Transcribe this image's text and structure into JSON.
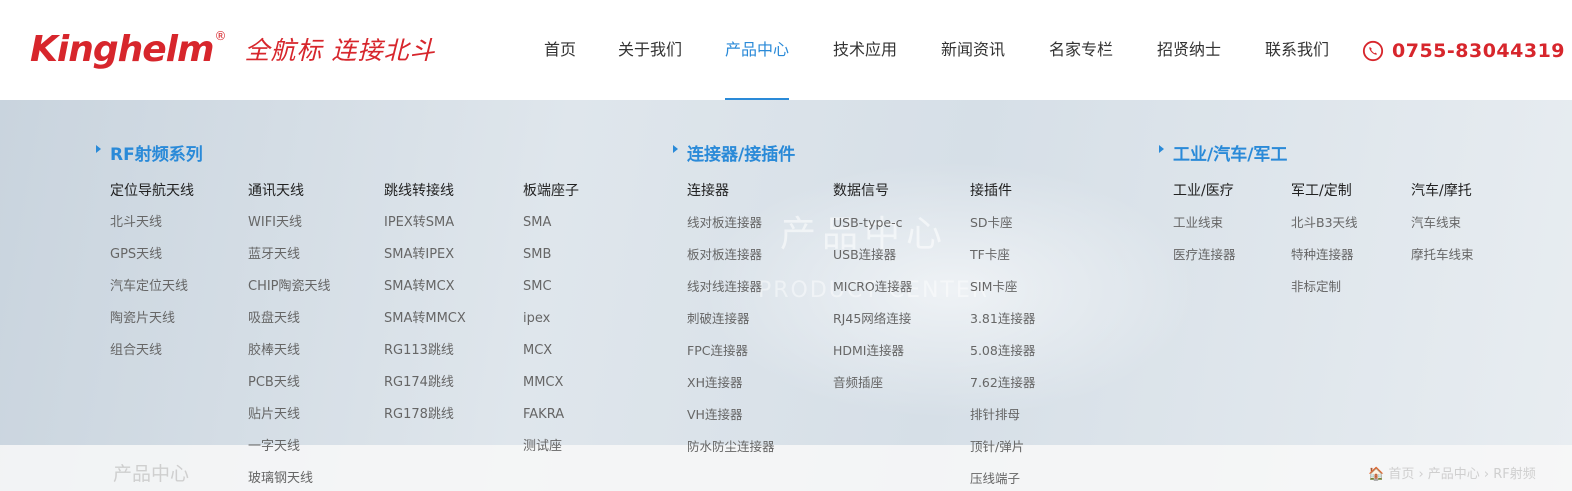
{
  "brand": {
    "logo_text": "Kinghelm",
    "registered": "®",
    "slogan": "全航标 连接北斗"
  },
  "nav": [
    {
      "label": "首页",
      "active": false
    },
    {
      "label": "关于我们",
      "active": false
    },
    {
      "label": "产品中心",
      "active": true
    },
    {
      "label": "技术应用",
      "active": false
    },
    {
      "label": "新闻资讯",
      "active": false
    },
    {
      "label": "名家专栏",
      "active": false
    },
    {
      "label": "招贤纳士",
      "active": false
    },
    {
      "label": "联系我们",
      "active": false
    }
  ],
  "phone": {
    "icon": "phone-icon",
    "number": "0755-83044319"
  },
  "banner": {
    "title": "产品中心",
    "subtitle": "PRODUCT CENTER"
  },
  "subbar": {
    "title": "产品中心",
    "breadcrumb": "🏠 首页 › 产品中心 › RF射频"
  },
  "mega_menu": {
    "groups": [
      {
        "title": "RF射频系列",
        "columns": [
          {
            "heading": "定位导航天线",
            "items": [
              "北斗天线",
              "GPS天线",
              "汽车定位天线",
              "陶瓷片天线",
              "组合天线"
            ]
          },
          {
            "heading": "通讯天线",
            "items": [
              "WIFI天线",
              "蓝牙天线",
              "CHIP陶瓷天线",
              "吸盘天线",
              "胶棒天线",
              "PCB天线",
              "贴片天线",
              "一字天线",
              "玻璃钢天线"
            ]
          },
          {
            "heading": "跳线转接线",
            "items": [
              "IPEX转SMA",
              "SMA转IPEX",
              "SMA转MCX",
              "SMA转MMCX",
              "RG113跳线",
              "RG174跳线",
              "RG178跳线"
            ]
          },
          {
            "heading": "板端座子",
            "items": [
              "SMA",
              "SMB",
              "SMC",
              "ipex",
              "MCX",
              "MMCX",
              "FAKRA",
              "测试座"
            ]
          }
        ]
      },
      {
        "title": "连接器/接插件",
        "columns": [
          {
            "heading": "连接器",
            "items": [
              "线对板连接器",
              "板对板连接器",
              "线对线连接器",
              "刺破连接器",
              "FPC连接器",
              "XH连接器",
              "VH连接器",
              "防水防尘连接器"
            ]
          },
          {
            "heading": "数据信号",
            "items": [
              "USB-type-c",
              "USB连接器",
              "MICRO连接器",
              "RJ45网络连接",
              "HDMI连接器",
              "音频插座"
            ]
          },
          {
            "heading": "接插件",
            "items": [
              "SD卡座",
              "TF卡座",
              "SIM卡座",
              "3.81连接器",
              "5.08连接器",
              "7.62连接器",
              "排针排母",
              "顶针/弹片",
              "压线端子"
            ]
          }
        ]
      },
      {
        "title": "工业/汽车/军工",
        "columns": [
          {
            "heading": "工业/医疗",
            "items": [
              "工业线束",
              "医疗连接器"
            ]
          },
          {
            "heading": "军工/定制",
            "items": [
              "北斗B3天线",
              "特种连接器",
              "非标定制"
            ]
          },
          {
            "heading": "汽车/摩托",
            "items": [
              "汽车线束",
              "摩托车线束"
            ]
          }
        ]
      }
    ]
  },
  "colors": {
    "brand_red": "#d7262c",
    "accent_blue": "#2a8ad8"
  }
}
